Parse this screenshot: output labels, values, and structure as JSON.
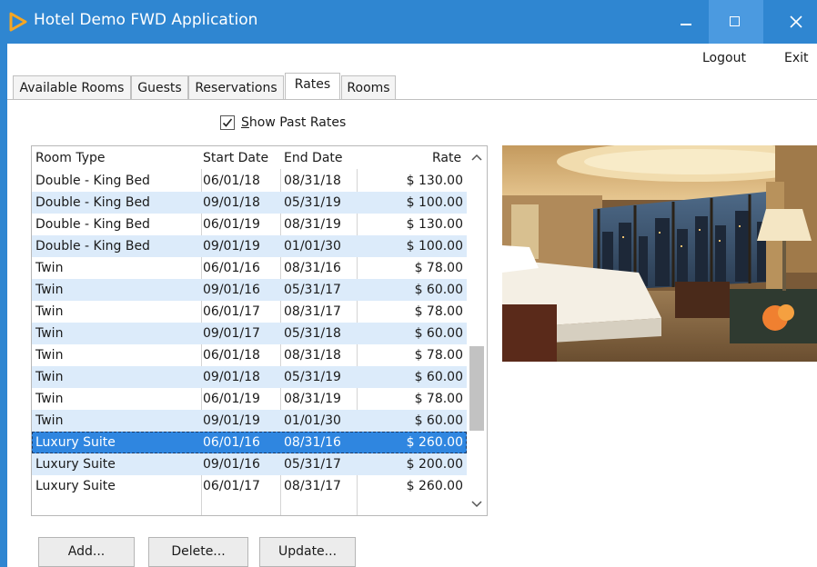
{
  "window": {
    "title": "Hotel Demo FWD Application"
  },
  "icons": {
    "app": "app-play-icon",
    "minimize": "minimize-icon",
    "maximize": "maximize-icon",
    "close": "close-icon",
    "check": "checkmark-icon",
    "scroll_up": "chevron-up-icon",
    "scroll_down": "chevron-down-icon"
  },
  "menu": {
    "logout": "Logout",
    "exit": "Exit"
  },
  "tabs": [
    {
      "label": "Available Rooms",
      "active": false
    },
    {
      "label": "Guests",
      "active": false
    },
    {
      "label": "Reservations",
      "active": false
    },
    {
      "label": "Rates",
      "active": true
    },
    {
      "label": "Rooms",
      "active": false
    }
  ],
  "show_past_rates": {
    "label_accel": "S",
    "label_rest": "how Past Rates",
    "checked": true
  },
  "table": {
    "columns": [
      "Room Type",
      "Start Date",
      "End Date",
      "Rate"
    ],
    "rows": [
      {
        "room_type": "Double - King Bed",
        "start_date": "06/01/18",
        "end_date": "08/31/18",
        "rate": "$ 130.00"
      },
      {
        "room_type": "Double - King Bed",
        "start_date": "09/01/18",
        "end_date": "05/31/19",
        "rate": "$ 100.00"
      },
      {
        "room_type": "Double - King Bed",
        "start_date": "06/01/19",
        "end_date": "08/31/19",
        "rate": "$ 130.00"
      },
      {
        "room_type": "Double - King Bed",
        "start_date": "09/01/19",
        "end_date": "01/01/30",
        "rate": "$ 100.00"
      },
      {
        "room_type": "Twin",
        "start_date": "06/01/16",
        "end_date": "08/31/16",
        "rate": "$ 78.00"
      },
      {
        "room_type": "Twin",
        "start_date": "09/01/16",
        "end_date": "05/31/17",
        "rate": "$ 60.00"
      },
      {
        "room_type": "Twin",
        "start_date": "06/01/17",
        "end_date": "08/31/17",
        "rate": "$ 78.00"
      },
      {
        "room_type": "Twin",
        "start_date": "09/01/17",
        "end_date": "05/31/18",
        "rate": "$ 60.00"
      },
      {
        "room_type": "Twin",
        "start_date": "06/01/18",
        "end_date": "08/31/18",
        "rate": "$ 78.00"
      },
      {
        "room_type": "Twin",
        "start_date": "09/01/18",
        "end_date": "05/31/19",
        "rate": "$ 60.00"
      },
      {
        "room_type": "Twin",
        "start_date": "06/01/19",
        "end_date": "08/31/19",
        "rate": "$ 78.00"
      },
      {
        "room_type": "Twin",
        "start_date": "09/01/19",
        "end_date": "01/01/30",
        "rate": "$ 60.00"
      },
      {
        "room_type": "Luxury Suite",
        "start_date": "06/01/16",
        "end_date": "08/31/16",
        "rate": "$ 260.00",
        "selected": true
      },
      {
        "room_type": "Luxury Suite",
        "start_date": "09/01/16",
        "end_date": "05/31/17",
        "rate": "$ 200.00"
      },
      {
        "room_type": "Luxury Suite",
        "start_date": "06/01/17",
        "end_date": "08/31/17",
        "rate": "$ 260.00"
      }
    ],
    "scroll": {
      "position": 0.74,
      "visible_fraction": 0.26
    }
  },
  "buttons": {
    "add": "Add...",
    "delete": "Delete...",
    "update": "Update..."
  },
  "colors": {
    "titlebar": "#2f86d1",
    "selection": "#2f86e0",
    "alt_row": "#dcebfa"
  }
}
